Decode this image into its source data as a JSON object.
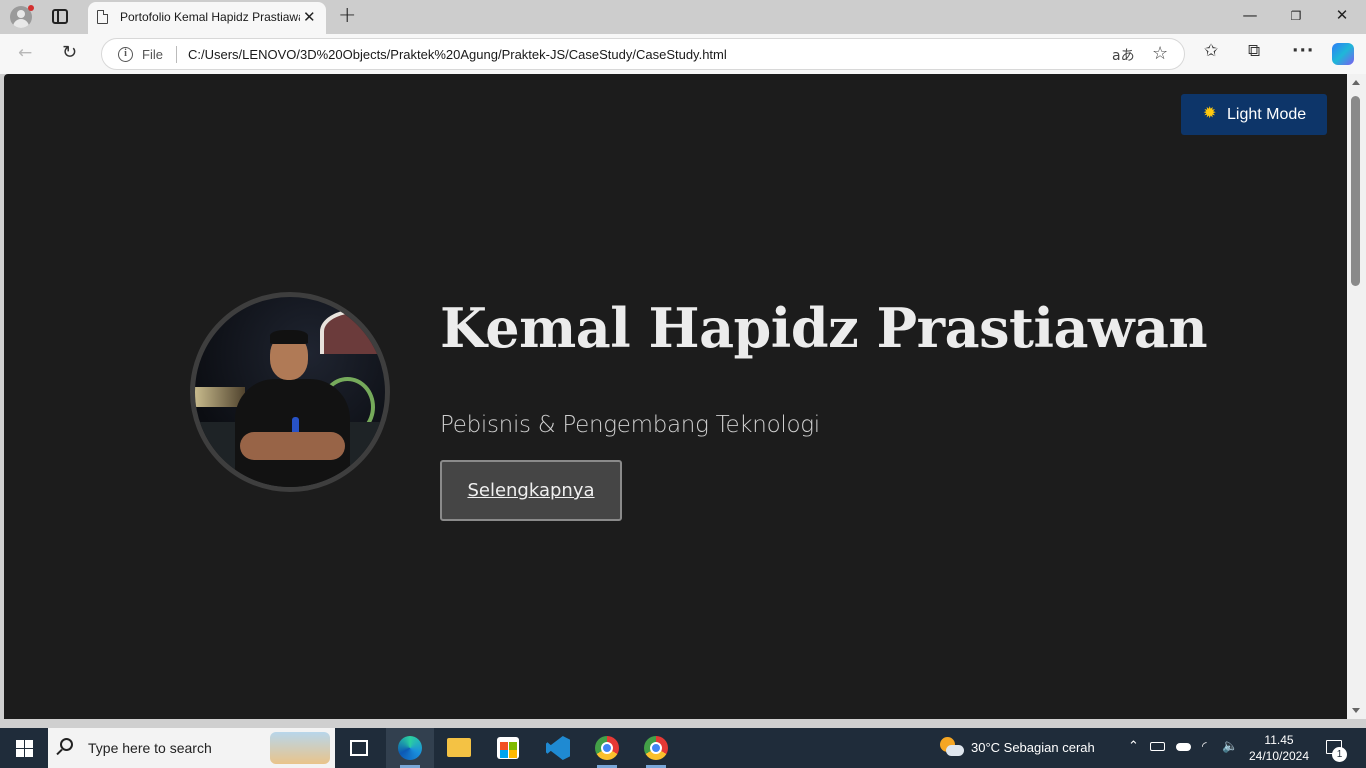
{
  "browser": {
    "tab_title": "Portofolio Kemal Hapidz Prastiawan",
    "new_tab_glyph": "+",
    "close_glyph": "✕",
    "scheme_label": "File",
    "url": "C:/Users/LENOVO/3D%20Objects/Praktek%20Agung/Praktek-JS/CaseStudy/CaseStudy.html",
    "read_aloud_glyph": "aあ",
    "star_glyph": "☆",
    "favorites_glyph": "✩",
    "collections_glyph": "⧉",
    "more_glyph": "···",
    "back_glyph": "←",
    "refresh_glyph": "↻",
    "minimize_glyph": "—",
    "maximize_glyph": "❐",
    "window_close_glyph": "✕"
  },
  "page": {
    "theme_toggle": {
      "icon": "sun-icon",
      "sun_glyph": "✹",
      "label": "Light Mode",
      "bg_color": "#0d3569"
    },
    "name": "Kemal Hapidz Prastiawan",
    "tagline": "Pebisnis & Pengembang Teknologi",
    "cta_label": "Selengkapnya",
    "background_color": "#1c1c1c"
  },
  "taskbar": {
    "search_placeholder": "Type here to search",
    "apps": [
      "task-view",
      "microsoft-edge",
      "file-explorer",
      "microsoft-store",
      "visual-studio-code",
      "google-chrome",
      "google-chrome"
    ],
    "weather": "30°C  Sebagian cerah",
    "tray_up_glyph": "⌃",
    "wifi_glyph": "◜",
    "volume_glyph": "🔈",
    "time": "11.45",
    "date": "24/10/2024",
    "notification_count": "1"
  }
}
